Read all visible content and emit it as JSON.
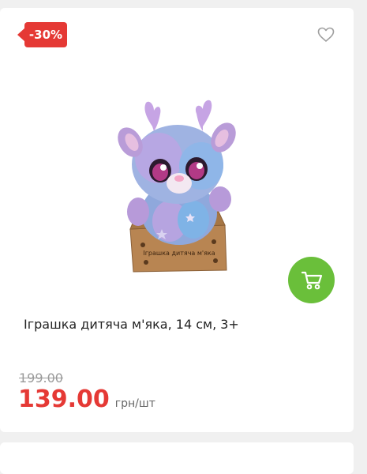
{
  "product": {
    "discount_badge": "-30%",
    "image_alt": "плюшевий олень у коробці",
    "box_text": "Іграшка дитяча м'яка",
    "title": "Іграшка дитяча м'яка, 14 см, 3+",
    "old_price": "199.00",
    "price": "139.00",
    "unit": "грн/шт"
  },
  "icons": {
    "favorite": "heart-outline-icon",
    "cart": "shopping-cart-icon"
  },
  "colors": {
    "badge": "#e53935",
    "price": "#e53935",
    "cart_button": "#6abf3a",
    "old_price": "#9a9a9a"
  }
}
